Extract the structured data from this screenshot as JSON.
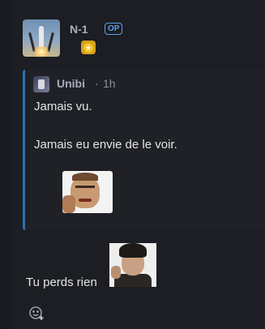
{
  "post": {
    "author": "N-1",
    "op_badge": "OP",
    "rank_badge_icon": "star-icon",
    "quote": {
      "author": "Unibi",
      "separator": "·",
      "time": "1h",
      "line1": "Jamais vu.",
      "line2": "Jamais eu envie de le voir."
    },
    "reply_text": "Tu perds rien"
  },
  "colors": {
    "background": "#181a1f",
    "card": "#1c1e23",
    "quote_bar": "#2f6fb5",
    "op_badge": "#5d9cec",
    "rank_badge": "#d6a317"
  }
}
